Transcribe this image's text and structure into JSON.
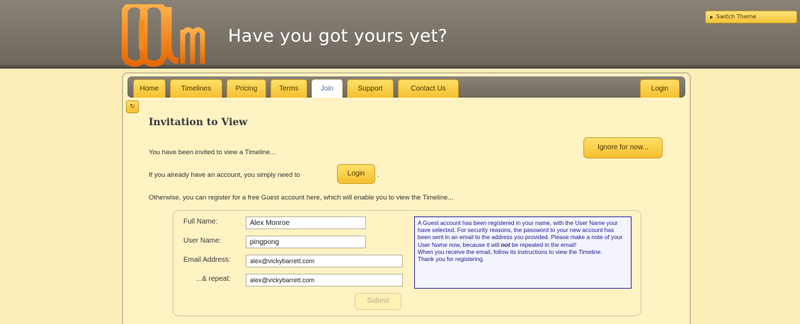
{
  "header": {
    "tagline": "Have you got yours yet?",
    "switch_theme": "Switch Theme"
  },
  "nav": {
    "tabs": [
      "Home",
      "Timelines",
      "Pricing",
      "Terms",
      "Join",
      "Support",
      "Contact Us"
    ],
    "active_tab": "Join",
    "login": "Login"
  },
  "main": {
    "title": "Invitation to View",
    "line1": "You have been invited to view a Timeline...",
    "line2_prefix": "If you already have an account, you simply need to",
    "line2_button": "Login",
    "line2_suffix": ".",
    "line3": "Otherwise, you can register for a free Guest account here, which will enable you to view the Timeline...",
    "ignore_button": "Ignore for now..."
  },
  "form": {
    "full_name_label": "Full Name:",
    "full_name_value": "Alex Monroe",
    "user_name_label": "User Name:",
    "user_name_value": "pingpong",
    "email_label": "Email Address:",
    "email_value": "alex@vickybarrett.com",
    "repeat_label": "...& repeat:",
    "repeat_value": "alex@vickybarrett.com",
    "submit": "Submit",
    "info_p1": "A Guest account has been registered in your name, with the User Name your have selected. For security reasons, the password to your new account has been sent in an email to the address you provided. Please make a note of your User Name now, because it will",
    "info_emph": "not",
    "info_p2": "be repeated in the email!",
    "info_p3": "When you receive the email, follow its instructions to view the Timeline.",
    "info_p4": "Thank you for registering."
  },
  "colors": {
    "header": "#7a7368",
    "background": "#fdeeb8",
    "panel": "#fff3c4",
    "button": "#f5c43a",
    "info_border": "#2a2aa0"
  }
}
